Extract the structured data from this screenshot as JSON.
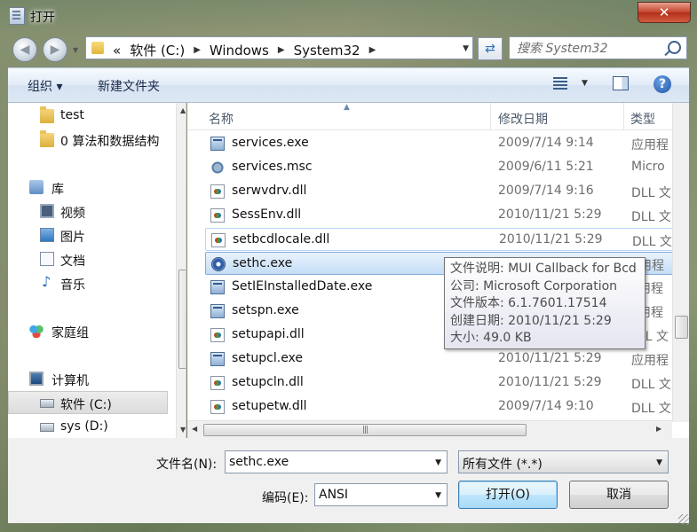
{
  "window": {
    "title": "打开",
    "close_label": "✕"
  },
  "address": {
    "crumbs": [
      "«",
      "软件 (C:)",
      "Windows",
      "System32"
    ],
    "search_placeholder": "搜索 System32"
  },
  "toolbar": {
    "organize": "组织 ▾",
    "new_folder": "新建文件夹",
    "help": "?"
  },
  "nav": {
    "items": [
      {
        "label": "test",
        "icon": "folder-icon"
      },
      {
        "label": "0 算法和数据结构",
        "icon": "folder-icon"
      },
      {
        "label": "库",
        "icon": "library-icon"
      },
      {
        "label": "视频",
        "icon": "video-icon"
      },
      {
        "label": "图片",
        "icon": "picture-icon"
      },
      {
        "label": "文档",
        "icon": "document-icon"
      },
      {
        "label": "音乐",
        "icon": "music-icon"
      },
      {
        "label": "家庭组",
        "icon": "homegroup-icon"
      },
      {
        "label": "计算机",
        "icon": "computer-icon"
      },
      {
        "label": "软件 (C:)",
        "icon": "drive-icon"
      },
      {
        "label": "sys (D:)",
        "icon": "drive-icon"
      }
    ],
    "selected": "软件 (C:)"
  },
  "columns": {
    "name": "名称",
    "date": "修改日期",
    "type": "类型"
  },
  "files": [
    {
      "name": "services.exe",
      "date": "2009/7/14 9:14",
      "type": "应用程",
      "icon": "exe-icon"
    },
    {
      "name": "services.msc",
      "date": "2009/6/11 5:21",
      "type": "Micro",
      "icon": "msc-icon"
    },
    {
      "name": "serwvdrv.dll",
      "date": "2009/7/14 9:16",
      "type": "DLL 文",
      "icon": "dll-icon"
    },
    {
      "name": "SessEnv.dll",
      "date": "2010/11/21 5:29",
      "type": "DLL 文",
      "icon": "dll-icon"
    },
    {
      "name": "setbcdlocale.dll",
      "date": "2010/11/21 5:29",
      "type": "DLL 文",
      "icon": "dll-icon"
    },
    {
      "name": "sethc.exe",
      "date": "",
      "type": "用程",
      "icon": "sethc-icon"
    },
    {
      "name": "SetIEInstalledDate.exe",
      "date": "",
      "type": "用程",
      "icon": "exe-icon"
    },
    {
      "name": "setspn.exe",
      "date": "",
      "type": "用程",
      "icon": "exe-icon"
    },
    {
      "name": "setupapi.dll",
      "date": "",
      "type": "LL 文",
      "icon": "dll-icon"
    },
    {
      "name": "setupcl.exe",
      "date": "2010/11/21 5:29",
      "type": "应用程",
      "icon": "exe-icon"
    },
    {
      "name": "setupcln.dll",
      "date": "2010/11/21 5:29",
      "type": "DLL 文",
      "icon": "dll-icon"
    },
    {
      "name": "setupetw.dll",
      "date": "2009/7/14 9:10",
      "type": "DLL 文",
      "icon": "dll-icon"
    }
  ],
  "tooltip": {
    "description": "文件说明: MUI Callback for Bcd",
    "company": "公司: Microsoft Corporation",
    "version": "文件版本: 6.1.7601.17514",
    "created": "创建日期: 2010/11/21 5:29",
    "size": "大小: 49.0 KB"
  },
  "form": {
    "filename_label": "文件名(N):",
    "filename_value": "sethc.exe",
    "filter_value": "所有文件  (*.*)",
    "encoding_label": "编码(E):",
    "encoding_value": "ANSI",
    "open_button": "打开(O)",
    "cancel_button": "取消"
  }
}
